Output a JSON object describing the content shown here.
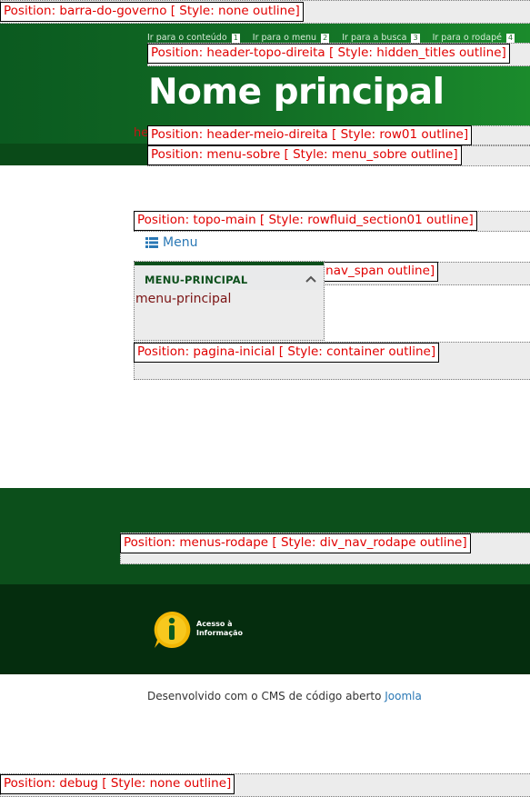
{
  "positions": {
    "barra_do_governo": "Position: barra-do-governo [ Style: none outline]",
    "header_topo_direita": "Position: header-topo-direita [ Style: hidden_titles outline]",
    "header_meio_direita": "Position: header-meio-direita [ Style: row01 outline]",
    "menu_sobre": "Position: menu-sobre [ Style: menu_sobre outline]",
    "topo_main": "Position: topo-main [ Style: rowfluid_section01 outline]",
    "nav_span_partial": "e: nav_span outline]",
    "pagina_inicial": "Position: pagina-inicial [ Style: container outline]",
    "menus_rodape": "Position: menus-rodape [ Style: div_nav_rodape outline]",
    "debug": "Position: debug [ Style: none outline]"
  },
  "accessibility": [
    {
      "label": "Ir para o conteúdo",
      "key": "1"
    },
    {
      "label": "Ir para o menu",
      "key": "2"
    },
    {
      "label": "Ir para a busca",
      "key": "3"
    },
    {
      "label": "Ir para o rodapé",
      "key": "4"
    }
  ],
  "header": {
    "title": "Nome principal",
    "partial_text": "he"
  },
  "menu": {
    "toggle_label": "Menu",
    "module_title": "MENU-PRINCIPAL",
    "module_item": "menu-principal"
  },
  "footer": {
    "access_info_line1": "Acesso à",
    "access_info_line2": "Informação",
    "credits_text": "Desenvolvido com o CMS de código aberto ",
    "credits_link": "Joomla"
  },
  "colors": {
    "header_green": "#116a24",
    "footer_green": "#0c4f1b",
    "footer_dark": "#052d0e",
    "outline_label_red": "#e00000",
    "link_blue": "#2a78b5"
  }
}
